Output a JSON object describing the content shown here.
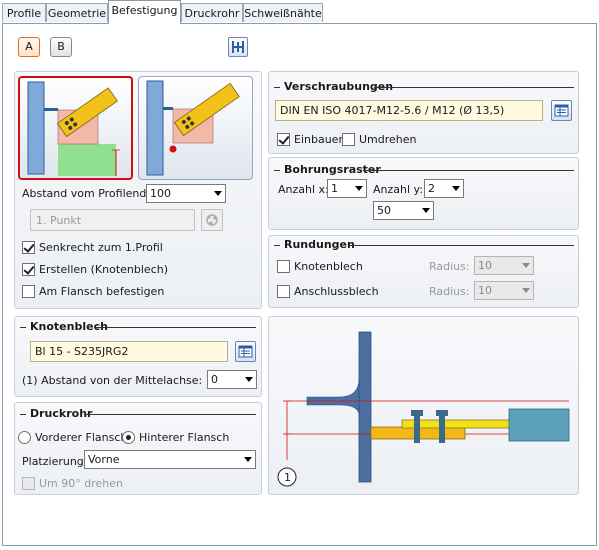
{
  "tabs": [
    "Profile",
    "Geometrie",
    "Befestigung",
    "Druckrohr",
    "Schweißnähte"
  ],
  "active_tab": "Befestigung",
  "variant_buttons": [
    "A",
    "B"
  ],
  "left": {
    "abstand_label": "Abstand vom Profilende:",
    "abstand_value": "100",
    "punkt_placeholder": "1. Punkt",
    "checks": [
      {
        "label": "Senkrecht zum 1.Profil",
        "checked": true
      },
      {
        "label": "Erstellen (Knotenblech)",
        "checked": true
      },
      {
        "label": "Am Flansch befestigen",
        "checked": false
      }
    ]
  },
  "verschraubungen": {
    "title": "Verschraubungen",
    "value": "DIN EN ISO 4017-M12-5.6 / M12 (Ø 13,5)",
    "einbauen_label": "Einbauen",
    "einbauen_checked": true,
    "umdrehen_label": "Umdrehen",
    "umdrehen_checked": false
  },
  "bohrungsraster": {
    "title": "Bohrungsraster",
    "anzahl_x_label": "Anzahl x:",
    "anzahl_x": "1",
    "anzahl_y_label": "Anzahl y:",
    "anzahl_y": "2",
    "abstand": "50"
  },
  "rundungen": {
    "title": "Rundungen",
    "rows": [
      {
        "label": "Knotenblech",
        "radius_label": "Radius:",
        "radius": "10"
      },
      {
        "label": "Anschlussblech",
        "radius_label": "Radius:",
        "radius": "10"
      }
    ]
  },
  "knotenblech": {
    "title": "Knotenblech",
    "value": "Bl 15 - S235JRG2",
    "mittelachse_label": "(1) Abstand von der Mittelachse:",
    "mittelachse_value": "0"
  },
  "druckrohr": {
    "title": "Druckrohr",
    "vorderer_label": "Vorderer Flansch",
    "hinterer_label": "Hinterer Flansch",
    "selected": "Hinterer Flansch",
    "platzierung_label": "Platzierung:",
    "platzierung_value": "Vorne",
    "um90_label": "Um 90° drehen"
  },
  "diagram": {
    "marker": "1"
  },
  "colors": {
    "accent_orange": "#e07020",
    "selected_red": "#d01010",
    "column_blue": "#3d6fa8",
    "plate_yellow": "#f2d21a",
    "field_yellow": "#fffbe0"
  }
}
